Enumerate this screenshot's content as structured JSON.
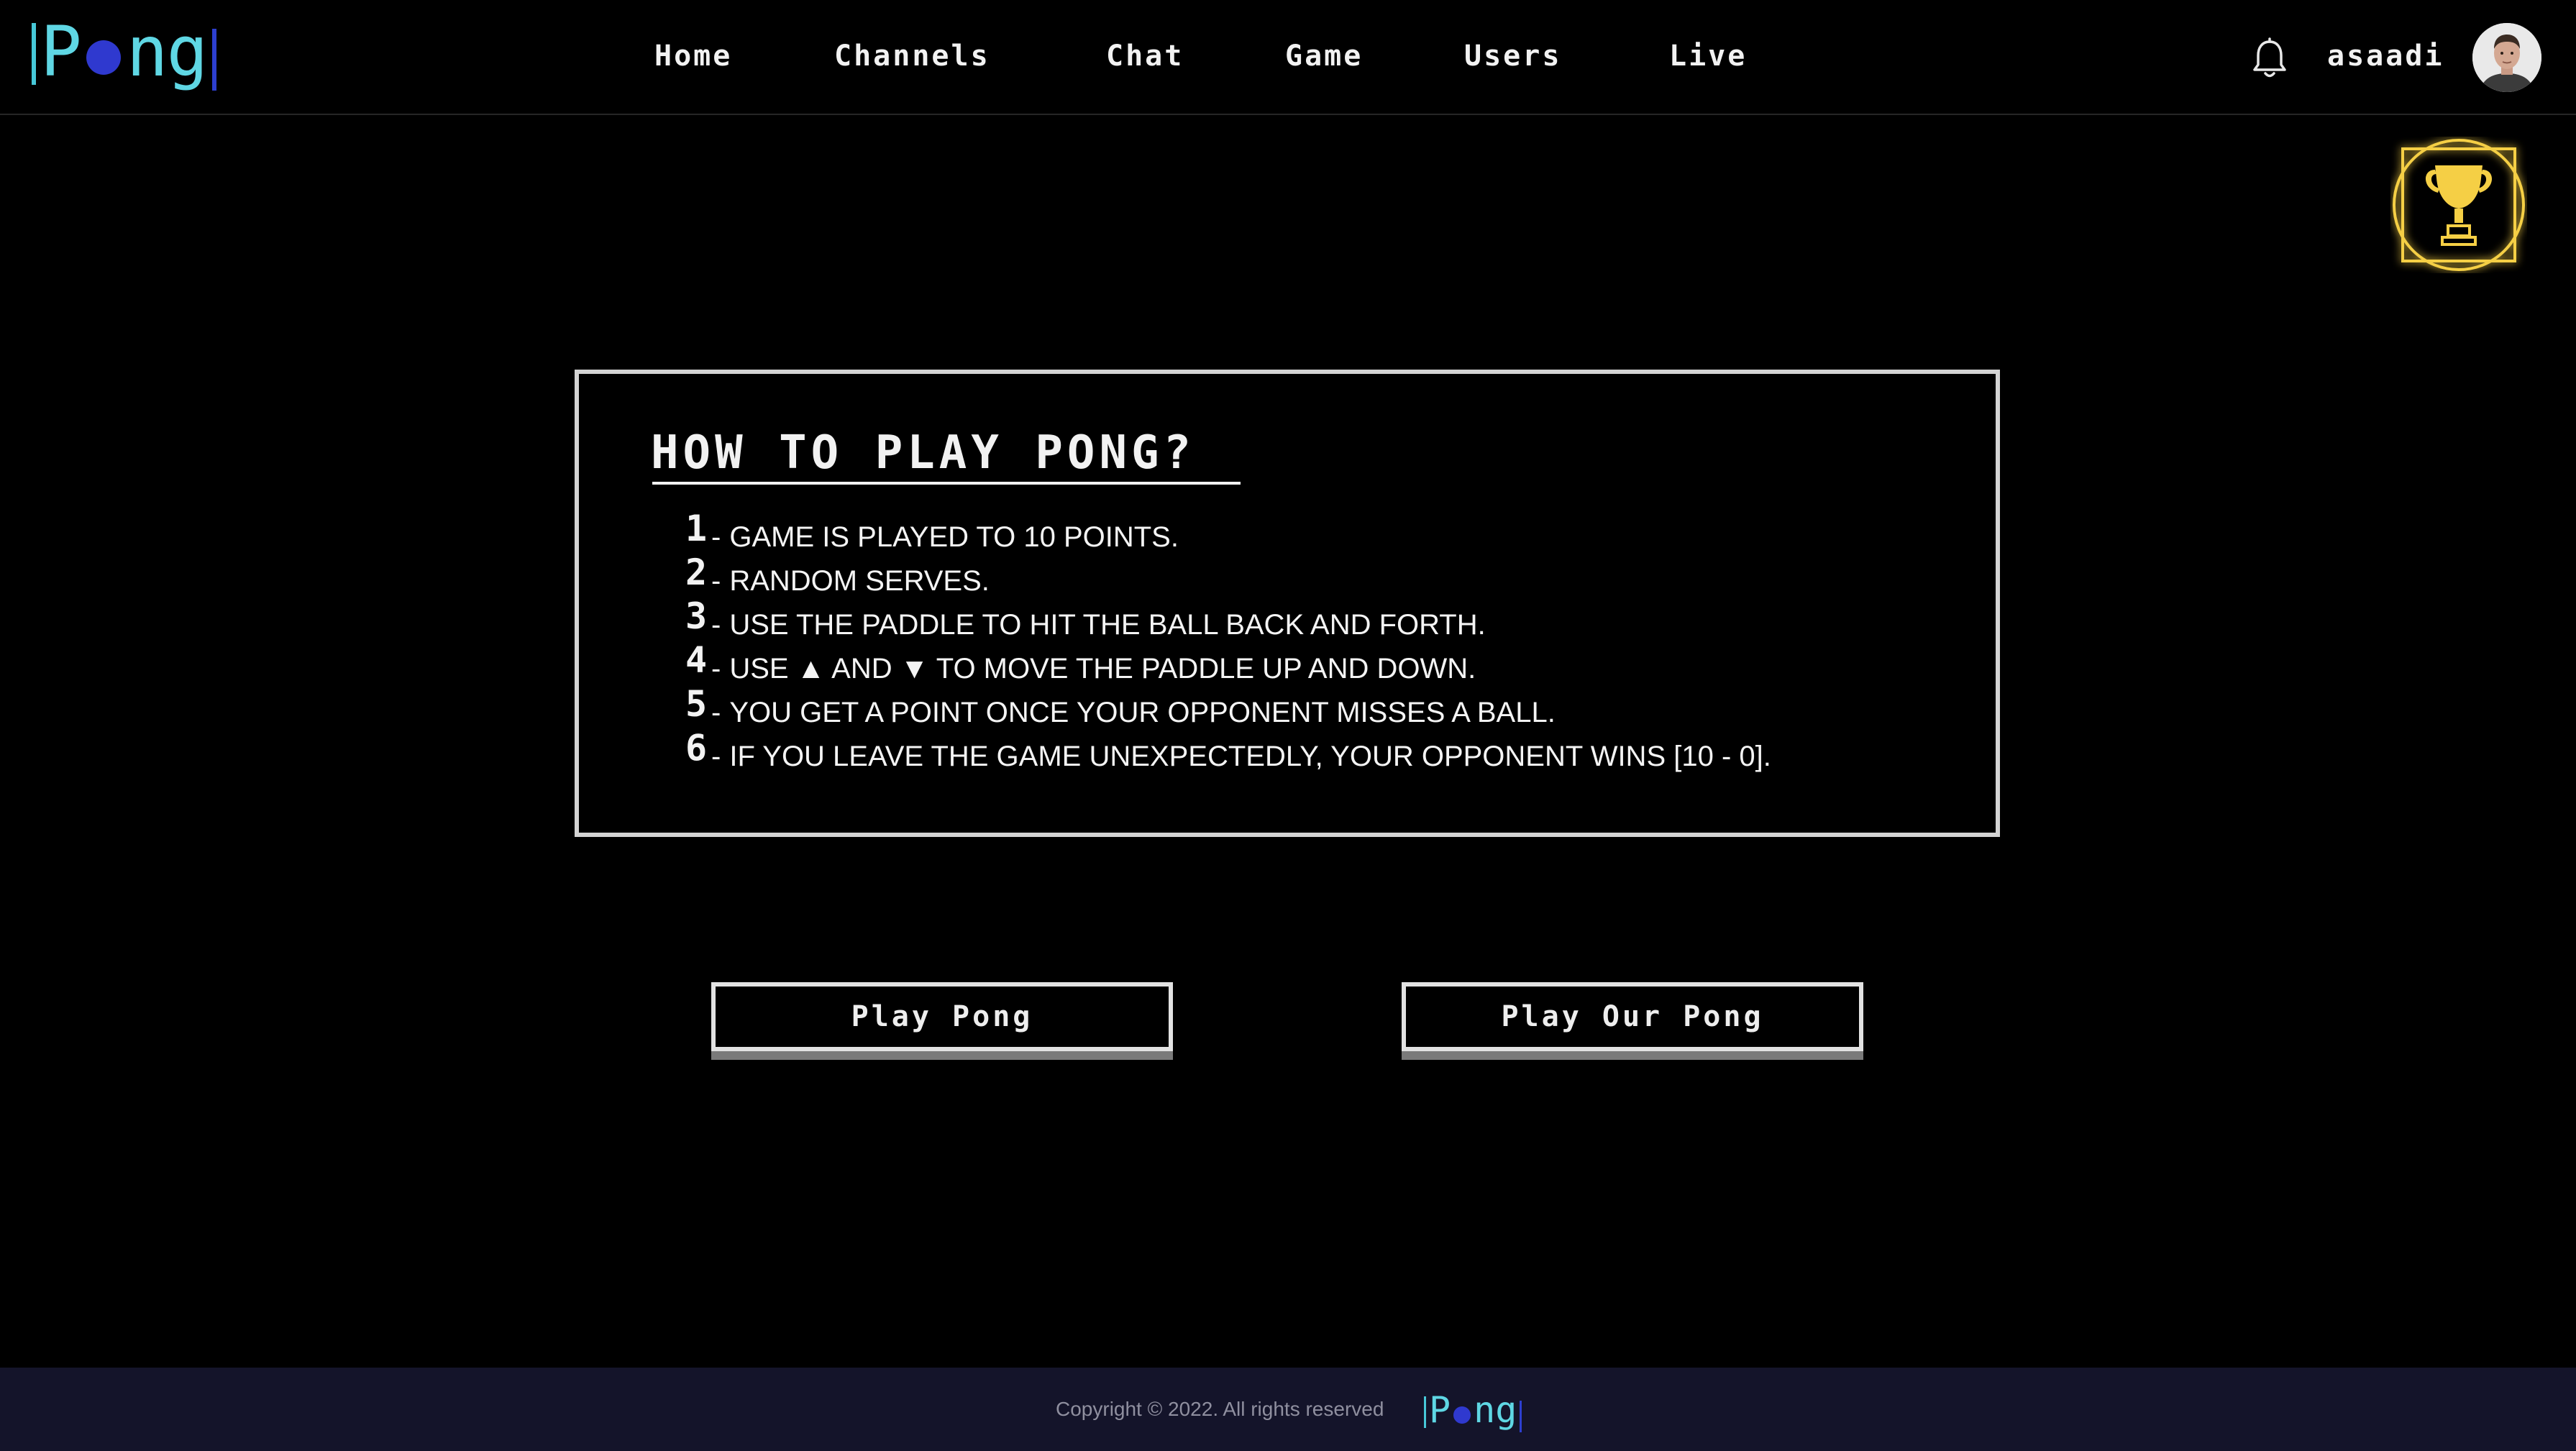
{
  "header": {
    "logo": {
      "pre": "P",
      "post": "ng"
    },
    "nav": [
      {
        "label": "Home"
      },
      {
        "label": "Channels"
      },
      {
        "label": "Chat"
      },
      {
        "label": "Game"
      },
      {
        "label": "Users"
      },
      {
        "label": "Live"
      }
    ],
    "notifications_icon": "bell-icon",
    "username": "asaadi",
    "avatar_icon": "user-avatar"
  },
  "trophy": {
    "icon": "trophy-icon",
    "color": "#f5cf45"
  },
  "rules": {
    "title": "HOW TO PLAY PONG?",
    "items": [
      {
        "num": "1",
        "text": "GAME IS PLAYED TO 10 POINTS."
      },
      {
        "num": "2",
        "text": "RANDOM SERVES."
      },
      {
        "num": "3",
        "text": "USE THE PADDLE TO HIT THE BALL BACK AND FORTH."
      },
      {
        "num": "4",
        "text": "USE ▲ AND ▼ TO MOVE THE PADDLE UP AND DOWN."
      },
      {
        "num": "5",
        "text": "YOU GET A POINT ONCE YOUR OPPONENT MISSES A BALL."
      },
      {
        "num": "6",
        "text": "IF YOU LEAVE THE GAME UNEXPECTEDLY, YOUR OPPONENT WINS [10 - 0]."
      }
    ]
  },
  "buttons": {
    "play_pong": "Play Pong",
    "play_our_pong": "Play Our Pong"
  },
  "footer": {
    "copyright": "Copyright © 2022. All rights reserved",
    "logo": {
      "pre": "P",
      "post": "ng"
    }
  },
  "colors": {
    "background": "#000000",
    "logo_cyan": "#5fd7e4",
    "logo_blue": "#2f39cf",
    "trophy_gold": "#f5cf45",
    "footer_bg": "#14142a"
  }
}
